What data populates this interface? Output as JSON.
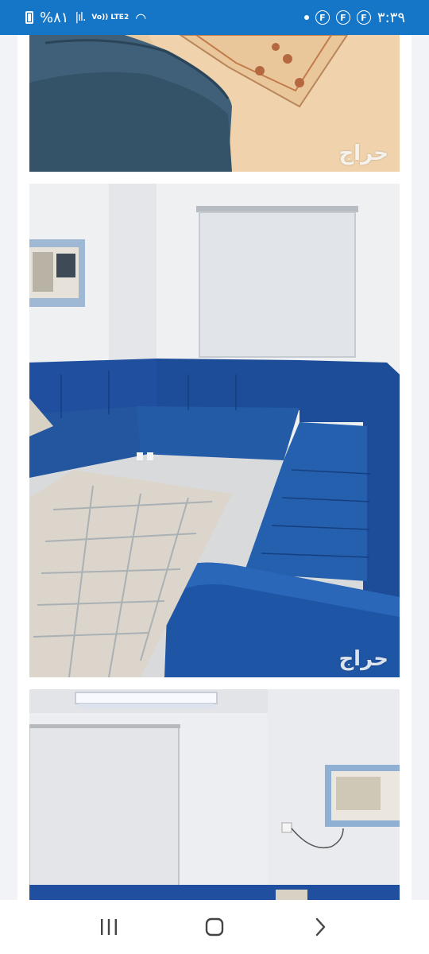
{
  "status_bar": {
    "battery_text": "%٨١",
    "network_label": "Vo)) LTE2",
    "time": "٣:٣٩",
    "notification_icons": [
      "F",
      "F",
      "F"
    ]
  },
  "gallery": {
    "images": [
      {
        "alt": "Blue sofa corner on patterned tile floor",
        "watermark": "حراج"
      },
      {
        "alt": "Blue L-shaped sectional sofa in white room with rug",
        "watermark": "حراج"
      },
      {
        "alt": "White room with window blind, fluorescent light and AC unit",
        "watermark": ""
      }
    ]
  },
  "nav_bar": {
    "recents": "recent-apps",
    "home": "home",
    "back": "back"
  },
  "colors": {
    "status_bar": "#1575c7",
    "sofa_blue": "#1f4f9e",
    "background": "#f2f3f7"
  }
}
